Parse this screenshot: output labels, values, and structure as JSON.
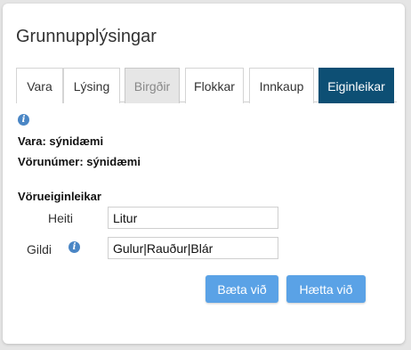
{
  "page": {
    "title": "Grunnupplýsingar"
  },
  "tabs": [
    {
      "label": "Vara",
      "state": "normal"
    },
    {
      "label": "Lýsing",
      "state": "normal"
    },
    {
      "label": "Birgðir",
      "state": "disabled"
    },
    {
      "label": "Flokkar",
      "state": "normal"
    },
    {
      "label": "Innkaup",
      "state": "normal"
    },
    {
      "label": "Eiginleikar",
      "state": "active"
    }
  ],
  "info": {
    "icon": "info-icon",
    "glyph": "i"
  },
  "product": {
    "line1": "Vara: sýnidæmi",
    "line2": "Vörunúmer: sýnidæmi"
  },
  "form": {
    "section_title": "Vörueiginleikar",
    "heiti_label": "Heiti",
    "heiti_value": "Litur",
    "gildi_label": "Gildi",
    "gildi_value": "Gulur|Rauður|Blár"
  },
  "buttons": {
    "save_label": "Bæta við",
    "cancel_label": "Hætta við"
  },
  "colors": {
    "active_tab": "#0d4f74",
    "disabled_tab": "#e6e6e6",
    "button": "#5aa2e6",
    "info_icon": "#4a86c5"
  }
}
